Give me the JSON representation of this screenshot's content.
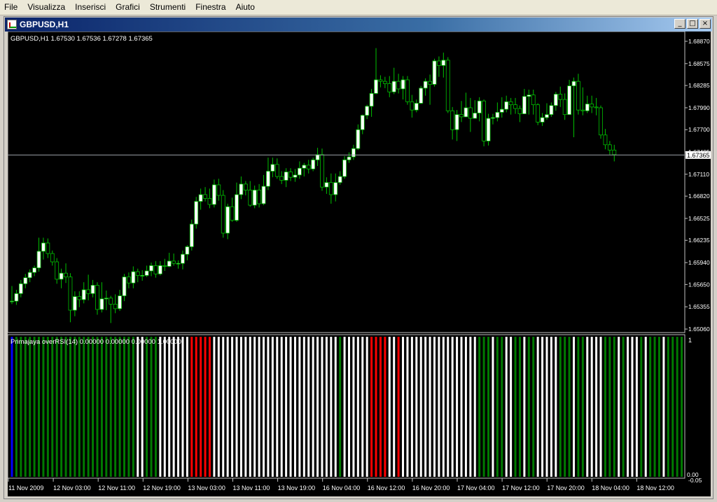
{
  "menu": [
    "File",
    "Visualizza",
    "Inserisci",
    "Grafici",
    "Strumenti",
    "Finestra",
    "Aiuto"
  ],
  "window": {
    "title": "GBPUSD,H1",
    "btn_min": "_",
    "btn_max": "□",
    "btn_close": "×"
  },
  "colors": {
    "bull": "#ffffff",
    "bear": "#000000",
    "wick": "#00c000",
    "bidline": "#9aa0a6",
    "hist_green": "#007a00",
    "hist_white": "#ffffff",
    "hist_red": "#ff0000",
    "hist_blue": "#0000ff"
  },
  "price_panel": {
    "info": "GBPUSD,H1  1.67530 1.67536 1.67278 1.67365",
    "current_price": "1.67365",
    "axis_labels": [
      "1.68870",
      "1.68575",
      "1.68285",
      "1.67990",
      "1.67700",
      "1.67405",
      "1.67110",
      "1.66820",
      "1.66525",
      "1.66235",
      "1.65940",
      "1.65650",
      "1.65355",
      "1.65060"
    ]
  },
  "indicator_panel": {
    "info": "Primajaya overRSI(14) 0.00000 0.00000 0.00000 1.00000",
    "axis_top": "1",
    "axis_bottom_a": "0.00",
    "axis_bottom_b": "-0.05",
    "bar_pattern": "bgggggggggggggggggggggggggggwwgggwwwwwwwrrrrrwwwwwwwwwwwwwwwwwwwwwwwwwwwwgwwwwwwrrrrwwrwwwwwwwwwwwwwwwwwgggwggwwggwggwwwwwgggwggwwwwgggwgwwwgwgggwgggg"
  },
  "time_axis": [
    "11 Nov 2009",
    "12 Nov 03:00",
    "12 Nov 11:00",
    "12 Nov 19:00",
    "13 Nov 03:00",
    "13 Nov 11:00",
    "13 Nov 19:00",
    "16 Nov 04:00",
    "16 Nov 12:00",
    "16 Nov 20:00",
    "17 Nov 04:00",
    "17 Nov 12:00",
    "17 Nov 20:00",
    "18 Nov 04:00",
    "18 Nov 12:00"
  ],
  "chart_data": {
    "type": "candlestick",
    "symbol": "GBPUSD",
    "timeframe": "H1",
    "y_range": [
      1.6506,
      1.6887
    ],
    "candles": [
      [
        1.6543,
        1.6543,
        1.6563,
        1.6539
      ],
      [
        1.6543,
        1.6553,
        1.6558,
        1.6538
      ],
      [
        1.6553,
        1.6566,
        1.6571,
        1.6548
      ],
      [
        1.6566,
        1.6574,
        1.6579,
        1.656
      ],
      [
        1.6574,
        1.6581,
        1.6585,
        1.6568
      ],
      [
        1.6581,
        1.6587,
        1.659,
        1.6576
      ],
      [
        1.6587,
        1.6609,
        1.6627,
        1.6582
      ],
      [
        1.6609,
        1.662,
        1.6627,
        1.6598
      ],
      [
        1.662,
        1.6606,
        1.6626,
        1.66
      ],
      [
        1.6606,
        1.6595,
        1.661,
        1.659
      ],
      [
        1.6595,
        1.6572,
        1.66,
        1.6566
      ],
      [
        1.6572,
        1.658,
        1.6586,
        1.656
      ],
      [
        1.658,
        1.6575,
        1.6593,
        1.6567
      ],
      [
        1.6575,
        1.6531,
        1.658,
        1.6515
      ],
      [
        1.6531,
        1.6549,
        1.6556,
        1.6523
      ],
      [
        1.6549,
        1.6545,
        1.6556,
        1.6535
      ],
      [
        1.6545,
        1.6558,
        1.6568,
        1.654
      ],
      [
        1.6558,
        1.6553,
        1.6578,
        1.6544
      ],
      [
        1.6553,
        1.6564,
        1.6571,
        1.6548
      ],
      [
        1.6564,
        1.6532,
        1.6568,
        1.6525
      ],
      [
        1.6532,
        1.6546,
        1.6568,
        1.6528
      ],
      [
        1.6546,
        1.6547,
        1.6557,
        1.6531
      ],
      [
        1.6547,
        1.6539,
        1.655,
        1.6514
      ],
      [
        1.6539,
        1.6533,
        1.6552,
        1.6527
      ],
      [
        1.6533,
        1.655,
        1.6558,
        1.653
      ],
      [
        1.655,
        1.6575,
        1.6579,
        1.6543
      ],
      [
        1.6575,
        1.6567,
        1.6581,
        1.656
      ],
      [
        1.6567,
        1.6582,
        1.6589,
        1.656
      ],
      [
        1.6582,
        1.6577,
        1.6586,
        1.6568
      ],
      [
        1.6577,
        1.6577,
        1.6584,
        1.657
      ],
      [
        1.6577,
        1.6583,
        1.659,
        1.6575
      ],
      [
        1.6583,
        1.659,
        1.6594,
        1.6576
      ],
      [
        1.659,
        1.6579,
        1.6596,
        1.6574
      ],
      [
        1.6579,
        1.659,
        1.6596,
        1.6577
      ],
      [
        1.659,
        1.6589,
        1.6599,
        1.6583
      ],
      [
        1.6589,
        1.6596,
        1.6607,
        1.6588
      ],
      [
        1.6596,
        1.6593,
        1.6606,
        1.659
      ],
      [
        1.6593,
        1.6593,
        1.6597,
        1.6586
      ],
      [
        1.6593,
        1.6605,
        1.661,
        1.6585
      ],
      [
        1.6605,
        1.6615,
        1.6617,
        1.6597
      ],
      [
        1.6615,
        1.6645,
        1.6651,
        1.661
      ],
      [
        1.6645,
        1.6675,
        1.6681,
        1.6639
      ],
      [
        1.6675,
        1.6684,
        1.6692,
        1.6664
      ],
      [
        1.6684,
        1.6679,
        1.6694,
        1.6675
      ],
      [
        1.6679,
        1.6671,
        1.6692,
        1.6666
      ],
      [
        1.6671,
        1.6697,
        1.6704,
        1.6667
      ],
      [
        1.6697,
        1.6683,
        1.6705,
        1.6676
      ],
      [
        1.6683,
        1.6633,
        1.669,
        1.6627
      ],
      [
        1.6633,
        1.6668,
        1.6672,
        1.6625
      ],
      [
        1.6668,
        1.665,
        1.668,
        1.6648
      ],
      [
        1.665,
        1.6684,
        1.67,
        1.6648
      ],
      [
        1.6684,
        1.6698,
        1.6708,
        1.6678
      ],
      [
        1.6698,
        1.669,
        1.6702,
        1.6683
      ],
      [
        1.669,
        1.667,
        1.6702,
        1.6668
      ],
      [
        1.667,
        1.669,
        1.6696,
        1.6666
      ],
      [
        1.669,
        1.6672,
        1.6698,
        1.6667
      ],
      [
        1.6672,
        1.6695,
        1.671,
        1.667
      ],
      [
        1.6695,
        1.6715,
        1.6733,
        1.669
      ],
      [
        1.6715,
        1.6724,
        1.6733,
        1.6707
      ],
      [
        1.6724,
        1.6708,
        1.6732,
        1.6705
      ],
      [
        1.6708,
        1.6703,
        1.6715,
        1.6698
      ],
      [
        1.6703,
        1.6714,
        1.6719,
        1.6694
      ],
      [
        1.6714,
        1.6707,
        1.6719,
        1.6702
      ],
      [
        1.6707,
        1.671,
        1.6718,
        1.6701
      ],
      [
        1.671,
        1.6719,
        1.6728,
        1.6705
      ],
      [
        1.6719,
        1.6723,
        1.6726,
        1.6708
      ],
      [
        1.6723,
        1.6718,
        1.673,
        1.6712
      ],
      [
        1.6718,
        1.673,
        1.6733,
        1.6715
      ],
      [
        1.673,
        1.6737,
        1.6746,
        1.6722
      ],
      [
        1.6737,
        1.6694,
        1.6745,
        1.6689
      ],
      [
        1.6694,
        1.67,
        1.6707,
        1.6685
      ],
      [
        1.67,
        1.6684,
        1.6712,
        1.6672
      ],
      [
        1.6684,
        1.67,
        1.6712,
        1.6675
      ],
      [
        1.67,
        1.6708,
        1.6715,
        1.6697
      ],
      [
        1.6708,
        1.673,
        1.6735,
        1.6705
      ],
      [
        1.673,
        1.6734,
        1.674,
        1.6726
      ],
      [
        1.6734,
        1.6745,
        1.675,
        1.673
      ],
      [
        1.6745,
        1.677,
        1.6777,
        1.6743
      ],
      [
        1.677,
        1.6789,
        1.679,
        1.6764
      ],
      [
        1.6789,
        1.6801,
        1.6803,
        1.6784
      ],
      [
        1.6801,
        1.6818,
        1.6824,
        1.6787
      ],
      [
        1.6818,
        1.6836,
        1.6878,
        1.6817
      ],
      [
        1.6836,
        1.6834,
        1.6842,
        1.6826
      ],
      [
        1.6834,
        1.6831,
        1.684,
        1.6825
      ],
      [
        1.6831,
        1.682,
        1.6841,
        1.6813
      ],
      [
        1.682,
        1.6834,
        1.6852,
        1.6817
      ],
      [
        1.6834,
        1.6824,
        1.6844,
        1.6818
      ],
      [
        1.6824,
        1.6836,
        1.6841,
        1.681
      ],
      [
        1.6836,
        1.6807,
        1.6841,
        1.6803
      ],
      [
        1.6807,
        1.6796,
        1.6816,
        1.6786
      ],
      [
        1.6796,
        1.6805,
        1.681,
        1.6793
      ],
      [
        1.6805,
        1.6825,
        1.6828,
        1.6804
      ],
      [
        1.6825,
        1.6834,
        1.6838,
        1.6815
      ],
      [
        1.6834,
        1.683,
        1.6843,
        1.6803
      ],
      [
        1.683,
        1.6861,
        1.6864,
        1.6827
      ],
      [
        1.6861,
        1.6855,
        1.6867,
        1.684
      ],
      [
        1.6855,
        1.6862,
        1.6872,
        1.6839
      ],
      [
        1.6862,
        1.6795,
        1.6866,
        1.6792
      ],
      [
        1.6795,
        1.677,
        1.68,
        1.6757
      ],
      [
        1.677,
        1.679,
        1.6796,
        1.6755
      ],
      [
        1.679,
        1.6787,
        1.6808,
        1.678
      ],
      [
        1.6787,
        1.6799,
        1.6819,
        1.6793
      ],
      [
        1.6799,
        1.6785,
        1.6812,
        1.6767
      ],
      [
        1.6785,
        1.6792,
        1.6809,
        1.6785
      ],
      [
        1.6792,
        1.6808,
        1.6813,
        1.6781
      ],
      [
        1.6808,
        1.6755,
        1.681,
        1.6748
      ],
      [
        1.6755,
        1.6785,
        1.6791,
        1.6749
      ],
      [
        1.6785,
        1.6786,
        1.6791,
        1.6777
      ],
      [
        1.6786,
        1.6793,
        1.6806,
        1.6781
      ],
      [
        1.6793,
        1.6797,
        1.6813,
        1.6786
      ],
      [
        1.6797,
        1.6807,
        1.6815,
        1.6793
      ],
      [
        1.6807,
        1.6803,
        1.6812,
        1.679
      ],
      [
        1.6803,
        1.6798,
        1.6812,
        1.6791
      ],
      [
        1.6798,
        1.6791,
        1.6802,
        1.678
      ],
      [
        1.6791,
        1.6814,
        1.6824,
        1.6791
      ],
      [
        1.6814,
        1.6816,
        1.6823,
        1.679
      ],
      [
        1.6816,
        1.6803,
        1.6823,
        1.679
      ],
      [
        1.6803,
        1.678,
        1.6805,
        1.6776
      ],
      [
        1.678,
        1.6786,
        1.6792,
        1.6775
      ],
      [
        1.6786,
        1.679,
        1.6805,
        1.6783
      ],
      [
        1.679,
        1.6802,
        1.6806,
        1.6787
      ],
      [
        1.6802,
        1.6817,
        1.682,
        1.6795
      ],
      [
        1.6817,
        1.681,
        1.6827,
        1.68
      ],
      [
        1.681,
        1.679,
        1.6818,
        1.6783
      ],
      [
        1.679,
        1.6828,
        1.6836,
        1.679
      ],
      [
        1.6828,
        1.6834,
        1.6839,
        1.676
      ],
      [
        1.6834,
        1.6796,
        1.6844,
        1.679
      ],
      [
        1.6796,
        1.6795,
        1.6826,
        1.6789
      ],
      [
        1.6795,
        1.6804,
        1.6815,
        1.6792
      ],
      [
        1.6804,
        1.68,
        1.6815,
        1.6792
      ],
      [
        1.68,
        1.6799,
        1.6812,
        1.6789
      ],
      [
        1.6799,
        1.6763,
        1.6802,
        1.6758
      ],
      [
        1.6763,
        1.675,
        1.6771,
        1.6744
      ],
      [
        1.675,
        1.6743,
        1.6755,
        1.6737
      ],
      [
        1.6743,
        1.6737,
        1.675,
        1.6728
      ]
    ],
    "current_price": 1.67365
  }
}
